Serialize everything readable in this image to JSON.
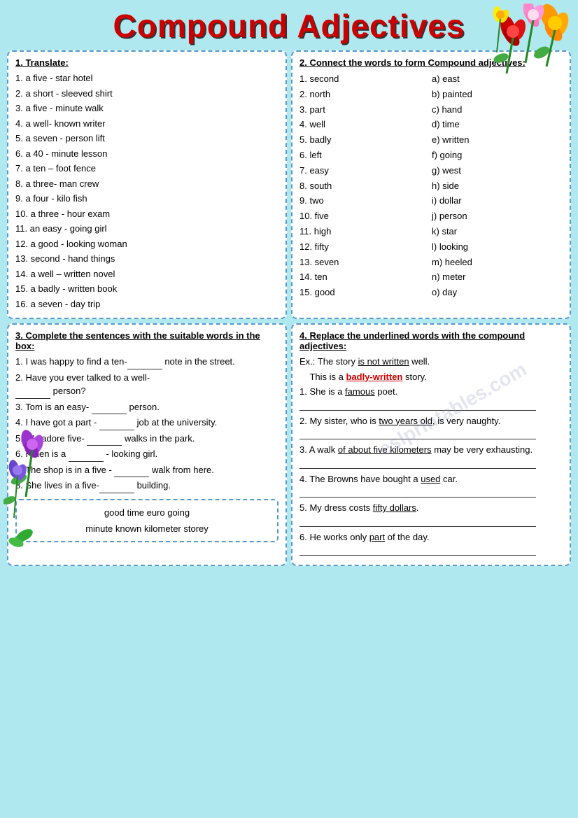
{
  "title": "Compound Adjectives",
  "section1": {
    "title": "1. Translate:",
    "items": [
      "1. a five - star hotel",
      "2. a short -   sleeved shirt",
      "3. a five - minute walk",
      "4. a well- known writer",
      "5. a seven - person lift",
      "6. a 40 -  minute lesson",
      "7. a ten – foot fence",
      "8. a three- man crew",
      "9. a four - kilo fish",
      "10. a three - hour exam",
      "11. an easy - going girl",
      "12. a good - looking woman",
      "13. second - hand things",
      "14. a well – written novel",
      "15. a badly -   written book",
      "16. a seven - day trip"
    ]
  },
  "section2": {
    "title": "2. Connect the words to form Compound adjectives:",
    "left_items": [
      "1. second",
      "2. north",
      "3. part",
      "4. well",
      "5. badly",
      "6. left",
      "7. easy",
      "8. south",
      "9. two",
      "10. five",
      "11. high",
      "12. fifty",
      "13. seven",
      "14. ten",
      "15. good"
    ],
    "right_items": [
      "a) east",
      "b) painted",
      "c) hand",
      "d) time",
      "e) written",
      "f) going",
      "g) west",
      "h) side",
      "i) dollar",
      "j) person",
      "k) star",
      "l) looking",
      "m) heeled",
      "n) meter",
      "o) day"
    ]
  },
  "section3": {
    "title": "3. Complete the sentences with the suitable words in the box:",
    "items": [
      {
        "text": "1. I was happy to find a ten-_____ note in the street."
      },
      {
        "text": "2. Have you ever talked to a well-_____ person?"
      },
      {
        "text": "3. Tom is an easy-  _____ person."
      },
      {
        "text": "4. I have got a part - _____ job at the university."
      },
      {
        "text": "5. We adore five- _____ walks in the park."
      },
      {
        "text": "6. Helen is a _______ - looking girl."
      },
      {
        "text": "7. The shop is in a five - _____ walk from here."
      },
      {
        "text": "8. She lives in a five-_____ building."
      }
    ],
    "wordbox": [
      "good    time    euro    going",
      "minute    known    kilometer    storey",
      "storey"
    ]
  },
  "section4": {
    "title": "4. Replace the underlined words with the compound adjectives:",
    "example_prefix": "Ex.: The story ",
    "example_underline": "is not written",
    "example_suffix": " well.",
    "example_line2_prefix": "This is a ",
    "example_line2_red": "badly-written",
    "example_line2_suffix": " story.",
    "items": [
      {
        "prefix": "1. She is a ",
        "underline": "famous",
        "suffix": " poet."
      },
      {
        "prefix": "2. My sister, who is ",
        "underline": "two years old",
        "suffix": ", is very naughty."
      },
      {
        "prefix": "3. A walk ",
        "underline": "of about five kilometers",
        "suffix": " may be very exhausting."
      },
      {
        "prefix": "4. The Browns have bought a ",
        "underline": "used",
        "suffix": " car."
      },
      {
        "prefix": "5. My dress costs ",
        "underline": "fifty dollars",
        "suffix": "."
      },
      {
        "prefix": "6. He works only ",
        "underline": "part",
        "suffix": " of the day."
      }
    ]
  },
  "watermark": "eslprintables.com"
}
